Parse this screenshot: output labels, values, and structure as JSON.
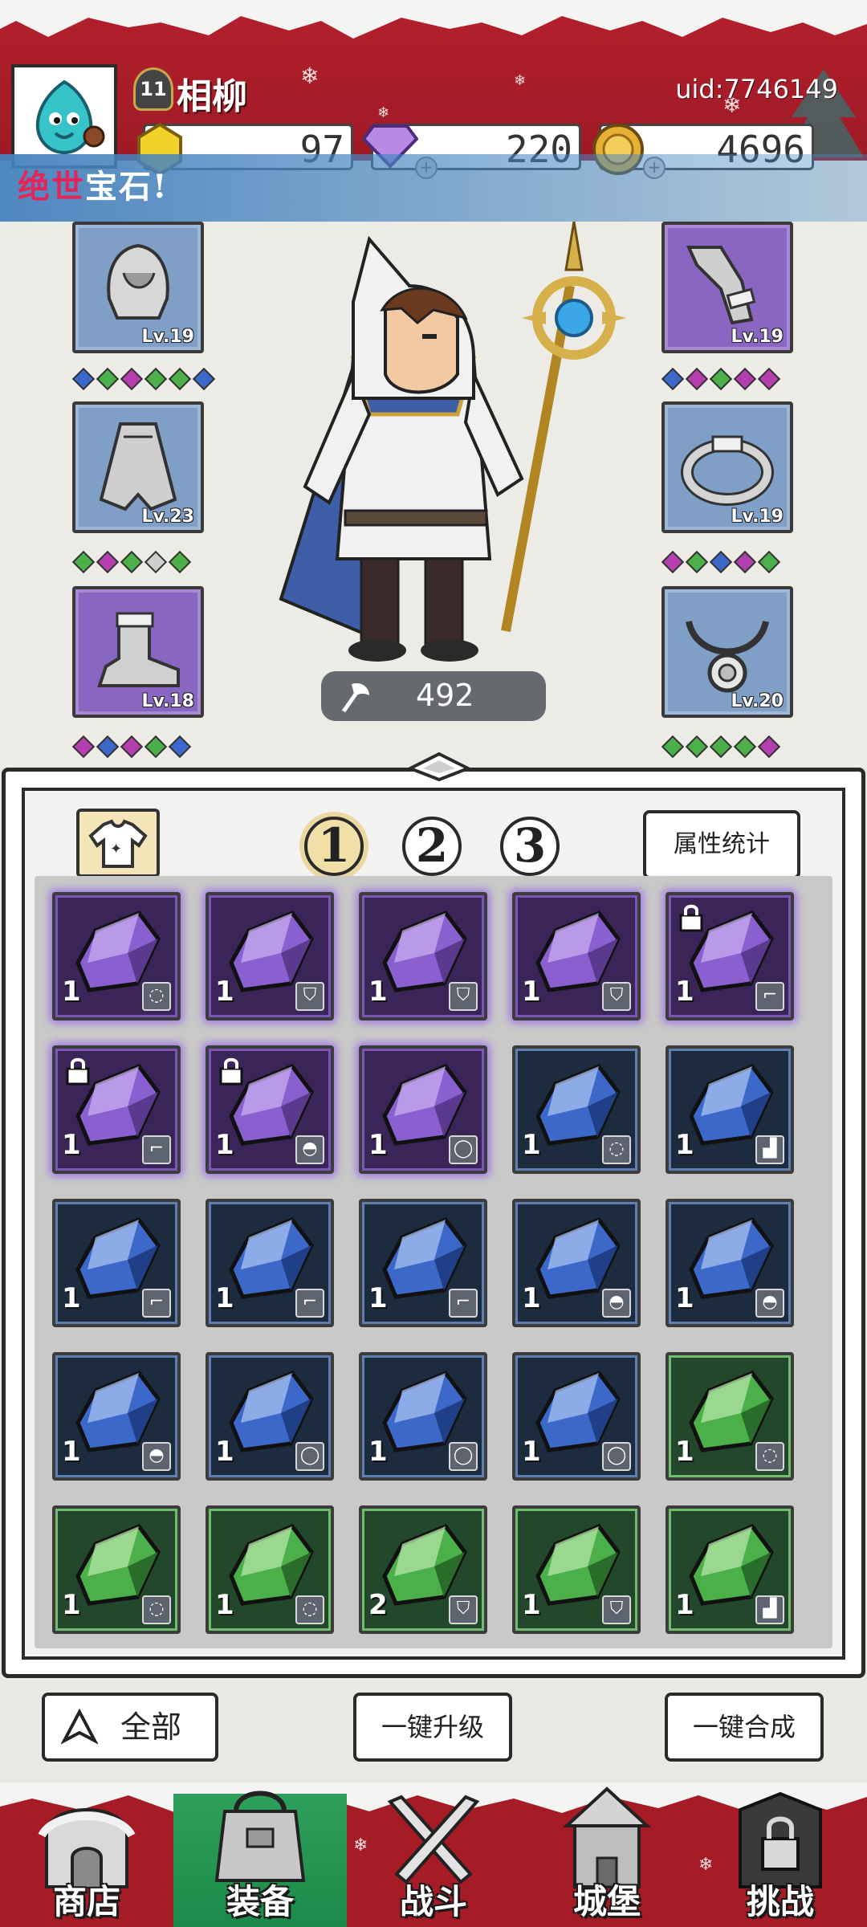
{
  "header": {
    "player_level": "11",
    "player_name": "相柳",
    "uid": "uid:7746149",
    "resources": [
      {
        "name": "gold-gem",
        "value": "97"
      },
      {
        "name": "diamond",
        "value": "220"
      },
      {
        "name": "coin",
        "value": "4696"
      }
    ]
  },
  "announcement": {
    "highlight": "绝世",
    "rest": "宝石!"
  },
  "equipment": {
    "slots": [
      {
        "name": "hood",
        "level": "Lv.19"
      },
      {
        "name": "cloak",
        "level": "Lv.23"
      },
      {
        "name": "boots",
        "level": "Lv.18"
      },
      {
        "name": "bracer",
        "level": "Lv.19"
      },
      {
        "name": "ring",
        "level": "Lv.19"
      },
      {
        "name": "amulet",
        "level": "Lv.20"
      }
    ],
    "power": "492"
  },
  "inventory": {
    "pages": [
      "1",
      "2",
      "3"
    ],
    "active_page": "1",
    "attr_button": "属性统计",
    "cells": [
      {
        "rarity": "purple",
        "count": "1",
        "slot": "ring",
        "locked": false
      },
      {
        "rarity": "purple",
        "count": "1",
        "slot": "cloak",
        "locked": false
      },
      {
        "rarity": "purple",
        "count": "1",
        "slot": "cloak",
        "locked": false
      },
      {
        "rarity": "purple",
        "count": "1",
        "slot": "cloak",
        "locked": false
      },
      {
        "rarity": "purple",
        "count": "1",
        "slot": "bracer",
        "locked": true
      },
      {
        "rarity": "purple",
        "count": "1",
        "slot": "bracer",
        "locked": true
      },
      {
        "rarity": "purple",
        "count": "1",
        "slot": "hood",
        "locked": true
      },
      {
        "rarity": "purple",
        "count": "1",
        "slot": "amulet",
        "locked": false
      },
      {
        "rarity": "blue",
        "count": "1",
        "slot": "ring",
        "locked": false
      },
      {
        "rarity": "blue",
        "count": "1",
        "slot": "boots",
        "locked": false
      },
      {
        "rarity": "blue",
        "count": "1",
        "slot": "bracer",
        "locked": false
      },
      {
        "rarity": "blue",
        "count": "1",
        "slot": "bracer",
        "locked": false
      },
      {
        "rarity": "blue",
        "count": "1",
        "slot": "bracer",
        "locked": false
      },
      {
        "rarity": "blue",
        "count": "1",
        "slot": "hood",
        "locked": false
      },
      {
        "rarity": "blue",
        "count": "1",
        "slot": "hood",
        "locked": false
      },
      {
        "rarity": "blue",
        "count": "1",
        "slot": "hood",
        "locked": false
      },
      {
        "rarity": "blue",
        "count": "1",
        "slot": "amulet",
        "locked": false
      },
      {
        "rarity": "blue",
        "count": "1",
        "slot": "amulet",
        "locked": false
      },
      {
        "rarity": "blue",
        "count": "1",
        "slot": "amulet",
        "locked": false
      },
      {
        "rarity": "green",
        "count": "1",
        "slot": "ring",
        "locked": false
      },
      {
        "rarity": "green",
        "count": "1",
        "slot": "ring",
        "locked": false
      },
      {
        "rarity": "green",
        "count": "1",
        "slot": "ring",
        "locked": false
      },
      {
        "rarity": "green",
        "count": "2",
        "slot": "cloak",
        "locked": false
      },
      {
        "rarity": "green",
        "count": "1",
        "slot": "cloak",
        "locked": false
      },
      {
        "rarity": "green",
        "count": "1",
        "slot": "boots",
        "locked": false
      }
    ]
  },
  "actions": {
    "filter": "全部",
    "upgrade_all": "一键升级",
    "merge_all": "一键合成"
  },
  "nav": {
    "items": [
      {
        "label": "商店",
        "icon": "shop-hut-icon"
      },
      {
        "label": "装备",
        "icon": "equipment-bag-icon"
      },
      {
        "label": "战斗",
        "icon": "crossed-swords-icon"
      },
      {
        "label": "城堡",
        "icon": "castle-icon"
      },
      {
        "label": "挑战",
        "icon": "locked-challenge-icon"
      }
    ],
    "active": "装备"
  },
  "colors": {
    "header_red": "#b5202d",
    "nav_green": "#1b8a48",
    "purple_gem": "#8a5fd0",
    "blue_gem": "#3c68c9",
    "green_gem": "#4cb04a",
    "highlight_pink": "#e2265a"
  }
}
